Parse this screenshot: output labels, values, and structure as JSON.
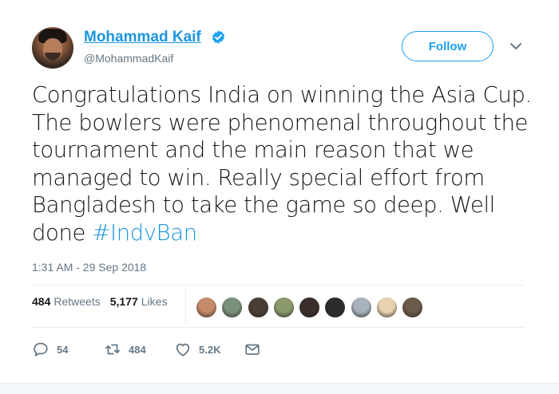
{
  "author": {
    "name": "Mohammad Kaif",
    "handle": "@MohammadKaif",
    "verified": true
  },
  "follow_label": "Follow",
  "tweet": {
    "text_before": "Congratulations India on winning the Asia Cup. The bowlers were phenomenal throughout the tournament and the main reason that we managed to win. Really special effort from Bangladesh to take the game so deep. Well done ",
    "hashtag": "#IndvBan",
    "timestamp": "1:31 AM - 29 Sep 2018"
  },
  "stats": {
    "retweets_count": "484",
    "retweets_label": "Retweets",
    "likes_count": "5,177",
    "likes_label": "Likes"
  },
  "likers": [
    "#c58a6a",
    "#7a8f7a",
    "#4a3d33",
    "#8a9a6a",
    "#3a2e2a",
    "#2c2c2c",
    "#a8b3bd",
    "#e8d2b0",
    "#6b5a4a"
  ],
  "actions": {
    "reply_count": "54",
    "retweet_count": "484",
    "like_count": "5.2K"
  },
  "colors": {
    "brand_blue": "#1da1f2",
    "link_blue": "#1b95e0",
    "muted": "#657786"
  }
}
